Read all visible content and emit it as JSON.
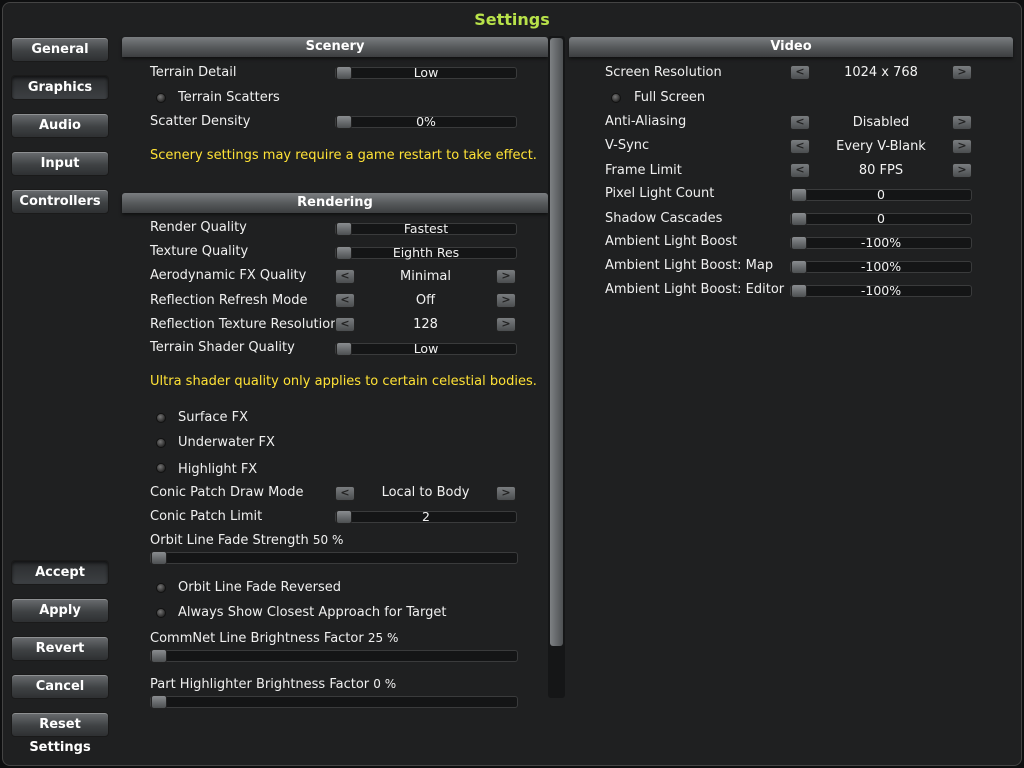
{
  "window": {
    "title": "Settings"
  },
  "nav": {
    "general": "General",
    "graphics": "Graphics",
    "audio": "Audio",
    "input": "Input",
    "controllers": "Controllers",
    "accept": "Accept",
    "apply": "Apply",
    "revert": "Revert",
    "cancel": "Cancel",
    "reset": "Reset Settings"
  },
  "scenery": {
    "header": "Scenery",
    "terrain_detail": {
      "label": "Terrain Detail",
      "value": "Low"
    },
    "terrain_scatters": {
      "label": "Terrain Scatters",
      "checked": false
    },
    "scatter_density": {
      "label": "Scatter Density",
      "value": "0%"
    },
    "note": "Scenery settings may require a game restart to take effect."
  },
  "rendering": {
    "header": "Rendering",
    "render_quality": {
      "label": "Render Quality",
      "value": "Fastest"
    },
    "texture_quality": {
      "label": "Texture Quality",
      "value": "Eighth Res"
    },
    "aero_fx": {
      "label": "Aerodynamic FX Quality",
      "value": "Minimal"
    },
    "refl_refresh": {
      "label": "Reflection Refresh Mode",
      "value": "Off"
    },
    "refl_tex_res": {
      "label": "Reflection Texture Resolution",
      "value": "128"
    },
    "terrain_shader": {
      "label": "Terrain Shader Quality",
      "value": "Low"
    },
    "note": "Ultra shader quality only applies to certain celestial bodies.",
    "surface_fx": {
      "label": "Surface FX",
      "checked": false
    },
    "underwater_fx": {
      "label": "Underwater FX",
      "checked": false
    },
    "highlight_fx": {
      "label": "Highlight FX",
      "checked": false
    },
    "conic_mode": {
      "label": "Conic Patch Draw Mode",
      "value": "Local to Body"
    },
    "conic_limit": {
      "label": "Conic Patch Limit",
      "value": "2"
    },
    "orbit_fade": {
      "label": "Orbit Line Fade Strength",
      "value": "50 %",
      "level": 0.0
    },
    "orbit_fade_rev": {
      "label": "Orbit Line Fade Reversed",
      "checked": false
    },
    "closest_approach": {
      "label": "Always Show Closest Approach for Target",
      "checked": false
    },
    "commnet": {
      "label": "CommNet Line Brightness Factor",
      "value": "25 %",
      "level": 0.0
    },
    "part_highlighter": {
      "label": "Part Highlighter Brightness Factor",
      "value": "0 %",
      "level": 0.0
    }
  },
  "video": {
    "header": "Video",
    "resolution": {
      "label": "Screen Resolution",
      "value": "1024 x 768"
    },
    "fullscreen": {
      "label": "Full Screen",
      "checked": false
    },
    "anti_aliasing": {
      "label": "Anti-Aliasing",
      "value": "Disabled"
    },
    "vsync": {
      "label": "V-Sync",
      "value": "Every V-Blank"
    },
    "frame_limit": {
      "label": "Frame Limit",
      "value": "80 FPS"
    },
    "pixel_light": {
      "label": "Pixel Light Count",
      "value": "0"
    },
    "shadow_cascades": {
      "label": "Shadow Cascades",
      "value": "0"
    },
    "ambient_boost": {
      "label": "Ambient Light Boost",
      "value": "-100%"
    },
    "ambient_boost_map": {
      "label": "Ambient Light Boost: Map",
      "value": "-100%"
    },
    "ambient_boost_editor": {
      "label": "Ambient Light Boost: Editor",
      "value": "-100%"
    }
  },
  "arrows": {
    "left": "<",
    "right": ">"
  },
  "colors": {
    "title": "#b8e24a",
    "note": "#ffe236",
    "background": "#1f2021"
  }
}
